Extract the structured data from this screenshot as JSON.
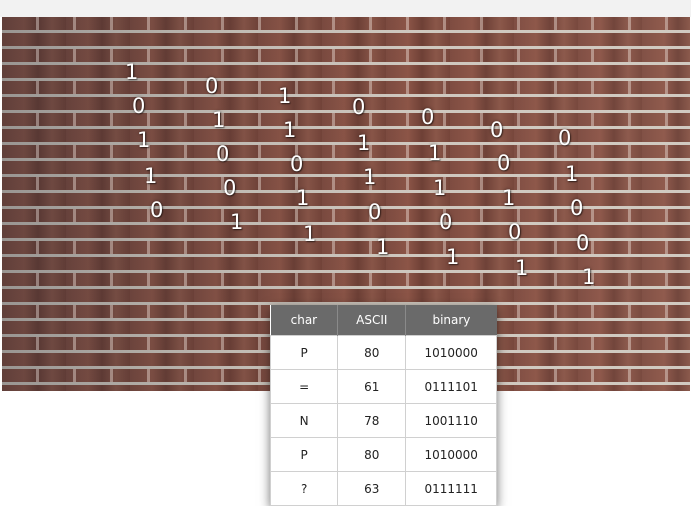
{
  "bits": [
    "1",
    "0",
    "1",
    "1",
    "0",
    "0",
    "1",
    "0",
    "0",
    "1",
    "1",
    "1",
    "0",
    "1",
    "1",
    "0",
    "1",
    "1",
    "0",
    "1",
    "0",
    "1",
    "1",
    "0",
    "1",
    "0",
    "0",
    "1",
    "0",
    "1",
    "0",
    "1",
    "0",
    "0",
    "1"
  ],
  "table": {
    "headers": [
      "char",
      "ASCII",
      "binary"
    ],
    "rows": [
      [
        "P",
        "80",
        "1010000"
      ],
      [
        "=",
        "61",
        "0111101"
      ],
      [
        "N",
        "78",
        "1001110"
      ],
      [
        "P",
        "80",
        "1010000"
      ],
      [
        "?",
        "63",
        "0111111"
      ]
    ]
  }
}
